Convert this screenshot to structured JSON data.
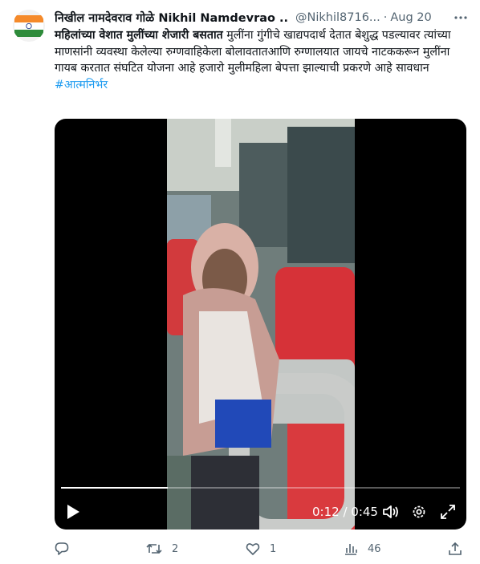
{
  "tweet": {
    "display_name": "निखील नामदेवराव गोळे Nikhil Namdevrao ...",
    "handle": "@Nikhil8716...",
    "separator": "·",
    "date": "Aug 20",
    "text_bold": "महिलांच्या वेशात मुलींच्या शेजारी बसतात",
    "text_rest": " मुलींना गुंगीचे खाद्यपदार्थ देतात बेशुद्ध पडल्यावर त्यांच्या माणसांनी व्यवस्था केलेल्या रुग्णवाहिकेला बोलावतातआणि रुग्णालयात जायचे नाटककरून मुलींना गायब करतात संघटित योजना आहे हजारो मुलीमहिला बेपत्ता झाल्याची प्रकरणे आहे सावधान",
    "hashtag": "#आत्मनिर्भर",
    "avatar_icon": "india-flag-icon",
    "more_icon": "more-options-icon"
  },
  "video": {
    "current_time": "0:12",
    "separator": " / ",
    "duration": "0:45",
    "progress": 0.267,
    "icons": [
      "play-icon",
      "volume-icon",
      "settings-icon",
      "fullscreen-icon"
    ]
  },
  "actions": {
    "reply_count": "",
    "retweet_count": "2",
    "like_count": "1",
    "views_count": "46",
    "icons": [
      "reply-icon",
      "retweet-icon",
      "like-icon",
      "views-icon",
      "share-icon"
    ]
  },
  "colors": {
    "link": "#1d9bf0",
    "secondary_text": "#536471",
    "primary_text": "#0f1419"
  }
}
